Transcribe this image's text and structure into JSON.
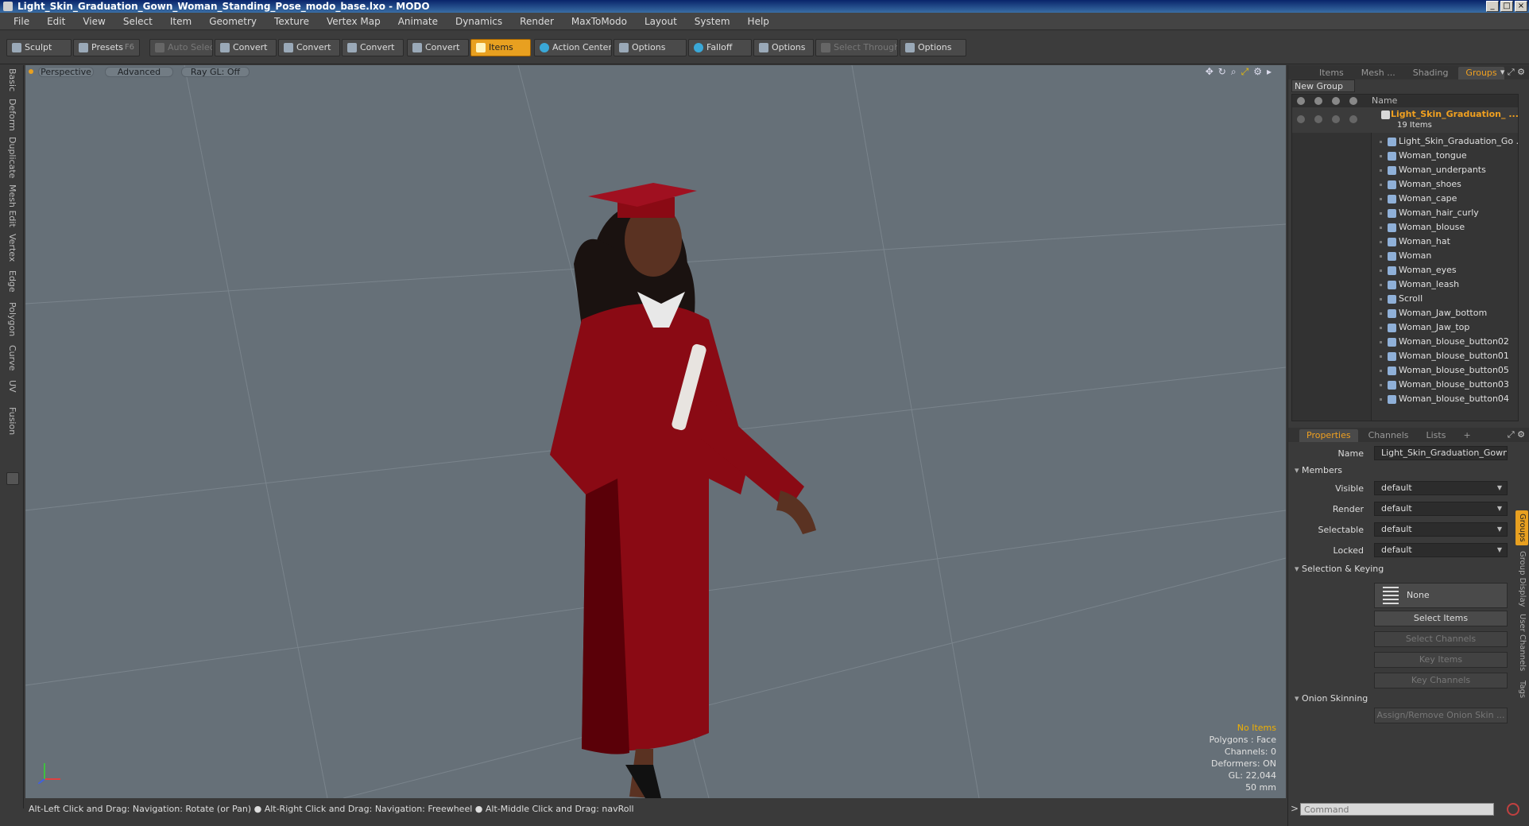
{
  "window": {
    "title": "Light_Skin_Graduation_Gown_Woman_Standing_Pose_modo_base.lxo - MODO",
    "buttons": [
      "_",
      "□",
      "×"
    ]
  },
  "menu": [
    "File",
    "Edit",
    "View",
    "Select",
    "Item",
    "Geometry",
    "Texture",
    "Vertex Map",
    "Animate",
    "Dynamics",
    "Render",
    "MaxToModo",
    "Layout",
    "System",
    "Help"
  ],
  "toolbar": {
    "sculpt": "Sculpt",
    "presets": "Presets",
    "presets_key": "F6",
    "auto_select": "Auto Select",
    "convert1": "Convert",
    "convert2": "Convert",
    "convert3": "Convert",
    "convert4": "Convert",
    "items": "Items",
    "action_center": "Action Center",
    "options1": "Options",
    "falloff": "Falloff",
    "options2": "Options",
    "select_through": "Select Through",
    "options3": "Options"
  },
  "left_tabs": [
    "Basic",
    "Deform",
    "Duplicate",
    "Mesh Edit",
    "Vertex",
    "Edge",
    "Polygon",
    "Curve",
    "UV",
    "Fusion"
  ],
  "viewport": {
    "perspective": "Perspective",
    "advanced": "Advanced",
    "raygl": "Ray GL: Off",
    "stats": {
      "items": "No Items",
      "polygons": "Polygons : Face",
      "channels": "Channels: 0",
      "deformers": "Deformers: ON",
      "gl": "GL: 22,044",
      "focal": "50 mm"
    },
    "colors": {
      "background": "#667078",
      "gown": "#8a0a14",
      "gown_shade": "#5a0008",
      "skin": "#5a3222",
      "hair": "#1a1210"
    }
  },
  "statusbar": "Alt-Left Click and Drag: Navigation: Rotate (or Pan) ● Alt-Right Click and Drag: Navigation: Freewheel ● Alt-Middle Click and Drag: navRoll",
  "items_panel": {
    "tabs": [
      "Items",
      "Mesh ...",
      "Shading",
      "Groups"
    ],
    "active_tab": "Groups",
    "new_group": "New Group",
    "name_col": "Name",
    "group": {
      "name": "Light_Skin_Graduation_ ...",
      "count": "19 Items"
    },
    "rows": [
      "Light_Skin_Graduation_Go ...",
      "Woman_tongue",
      "Woman_underpants",
      "Woman_shoes",
      "Woman_cape",
      "Woman_hair_curly",
      "Woman_blouse",
      "Woman_hat",
      "Woman",
      "Woman_eyes",
      "Woman_leash",
      "Scroll",
      "Woman_Jaw_bottom",
      "Woman_Jaw_top",
      "Woman_blouse_button02",
      "Woman_blouse_button01",
      "Woman_blouse_button05",
      "Woman_blouse_button03",
      "Woman_blouse_button04"
    ]
  },
  "properties": {
    "tabs": [
      "Properties",
      "Channels",
      "Lists",
      "+"
    ],
    "name_label": "Name",
    "name_value": "Light_Skin_Graduation_Gown_W",
    "members": "Members",
    "visible_label": "Visible",
    "visible_value": "default",
    "render_label": "Render",
    "render_value": "default",
    "selectable_label": "Selectable",
    "selectable_value": "default",
    "locked_label": "Locked",
    "locked_value": "default",
    "selection_keying": "Selection & Keying",
    "none": "None",
    "select_items": "Select Items",
    "select_channels": "Select Channels",
    "key_items": "Key Items",
    "key_channels": "Key Channels",
    "onion": "Onion Skinning",
    "assign_onion": "Assign/Remove Onion Skin ...",
    "side_tabs": [
      "Groups",
      "Group Display",
      "User Channels",
      "Tags"
    ]
  },
  "command": {
    "placeholder": "Command"
  }
}
